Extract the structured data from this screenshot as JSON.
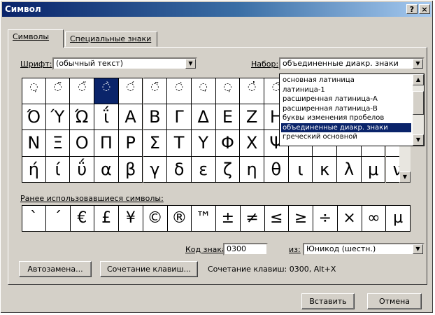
{
  "window": {
    "title": "Символ",
    "help_label": "?",
    "close_label": "×"
  },
  "tabs": [
    {
      "label": "Символы",
      "active": true
    },
    {
      "label": "Специальные знаки",
      "active": false
    }
  ],
  "font": {
    "label": "Шрифт:",
    "value": "(обычный текст)"
  },
  "subset": {
    "label": "Набор:",
    "value": "объединенные диакр. знаки",
    "options": [
      "основная латиница",
      "латиница-1",
      "расширенная латиница-A",
      "расширенная латиница-B",
      "буквы изменения пробелов",
      "объединенные диакр. знаки",
      "греческий основной"
    ],
    "selected_index": 5
  },
  "symbol_grid": {
    "rows": [
      [
        "̦",
        "̃",
        "̋",
        "̀",
        "́",
        "̃",
        "̇",
        "̣",
        "̦",
        "̓",
        "̈",
        "",
        "",
        "",
        "",
        ""
      ],
      [
        "Ό",
        "Ύ",
        "Ώ",
        "ΐ",
        "Α",
        "Β",
        "Γ",
        "Δ",
        "Ε",
        "Ζ",
        "Η",
        "",
        "",
        "",
        "",
        ""
      ],
      [
        "Ν",
        "Ξ",
        "Ο",
        "Π",
        "Ρ",
        "Σ",
        "Τ",
        "Υ",
        "Φ",
        "Χ",
        "Ψ",
        "",
        "",
        "",
        "",
        ""
      ],
      [
        "ή",
        "ί",
        "ΰ",
        "α",
        "β",
        "γ",
        "δ",
        "ε",
        "ζ",
        "η",
        "θ",
        "ι",
        "κ",
        "λ",
        "μ",
        "ν"
      ]
    ],
    "selected": [
      0,
      3
    ]
  },
  "recent": {
    "label": "Ранее использовавшиеся символы:",
    "symbols": [
      "`",
      "´",
      "€",
      "£",
      "¥",
      "©",
      "®",
      "™",
      "±",
      "≠",
      "≤",
      "≥",
      "÷",
      "×",
      "∞",
      "µ"
    ]
  },
  "char_code": {
    "label": "Код знака:",
    "value": "0300",
    "from_label": "из:",
    "from_value": "Юникод (шестн.)"
  },
  "buttons": {
    "autocorrect": "Автозамена...",
    "shortcut_key": "Сочетание клавиш...",
    "shortcut_text": "Сочетание клавиш: 0300, Alt+X",
    "insert": "Вставить",
    "cancel": "Отмена"
  }
}
